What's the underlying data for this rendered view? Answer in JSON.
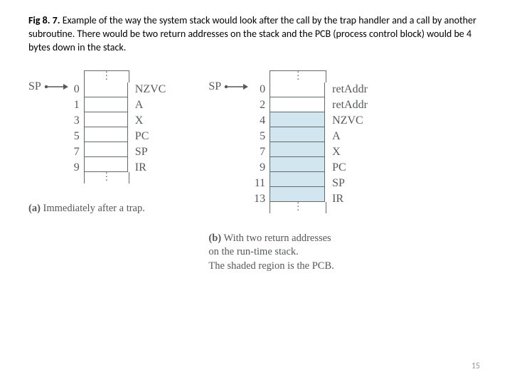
{
  "caption": {
    "label": "Fig 8. 7.",
    "text": "Example of the way the system stack would look after the call by the trap handler and a call by another subroutine.  There would be two return addresses on the stack and the PCB (process control block) would be 4 bytes down in the stack."
  },
  "sp_label": "SP",
  "figA": {
    "offsets": [
      "0",
      "1",
      "3",
      "5",
      "7",
      "9"
    ],
    "labels": [
      "NZVC",
      "A",
      "X",
      "PC",
      "SP",
      "IR"
    ],
    "caption_bold": "(a)",
    "caption_text": "Immediately after a trap."
  },
  "figB": {
    "offsets": [
      "0",
      "2",
      "4",
      "5",
      "7",
      "9",
      "11",
      "13"
    ],
    "labels": [
      "retAddr",
      "retAddr",
      "NZVC",
      "A",
      "X",
      "PC",
      "SP",
      "IR"
    ],
    "shaded_start": 2,
    "caption_bold": "(b)",
    "caption_text_l1": "With two return addresses",
    "caption_text_l2": "on the run-time stack.",
    "caption_text_l3": "The shaded region is the PCB."
  },
  "page_number": "15",
  "chart_data": {
    "type": "table",
    "title": "System stack contents",
    "series": [
      {
        "name": "Immediately after a trap",
        "offsets": [
          0,
          1,
          3,
          5,
          7,
          9
        ],
        "fields": [
          "NZVC",
          "A",
          "X",
          "PC",
          "SP",
          "IR"
        ]
      },
      {
        "name": "With two return addresses on the run-time stack",
        "offsets": [
          0,
          2,
          4,
          5,
          7,
          9,
          11,
          13
        ],
        "fields": [
          "retAddr",
          "retAddr",
          "NZVC",
          "A",
          "X",
          "PC",
          "SP",
          "IR"
        ],
        "pcb_range": [
          4,
          13
        ]
      }
    ]
  }
}
